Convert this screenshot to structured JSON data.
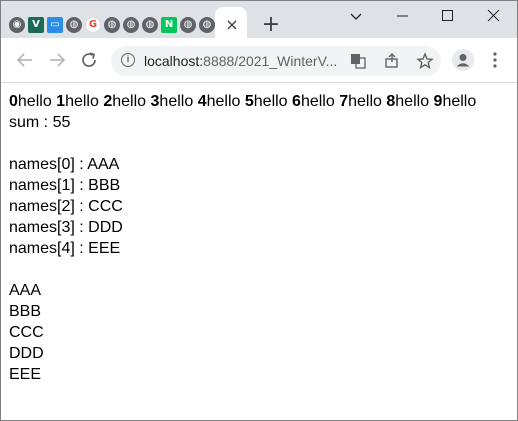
{
  "browser": {
    "favicons": [
      "github-icon",
      "v-icon",
      "chat-icon",
      "globe-icon",
      "google-icon",
      "globe-icon",
      "globe-icon",
      "globe-icon",
      "naver-icon",
      "globe-icon",
      "globe-icon"
    ],
    "url_host": "localhost:",
    "url_rest": "8888/2021_WinterV...",
    "tab_close_glyph": "×",
    "new_tab_glyph": "+"
  },
  "page": {
    "hello_items": [
      {
        "index": "0",
        "text": "hello"
      },
      {
        "index": "1",
        "text": "hello"
      },
      {
        "index": "2",
        "text": "hello"
      },
      {
        "index": "3",
        "text": "hello"
      },
      {
        "index": "4",
        "text": "hello"
      },
      {
        "index": "5",
        "text": "hello"
      },
      {
        "index": "6",
        "text": "hello"
      },
      {
        "index": "7",
        "text": "hello"
      },
      {
        "index": "8",
        "text": "hello"
      },
      {
        "index": "9",
        "text": "hello"
      }
    ],
    "sum_line": "sum : 55",
    "names_indexed": [
      "names[0] : AAA",
      "names[1] : BBB",
      "names[2] : CCC",
      "names[3] : DDD",
      "names[4] : EEE"
    ],
    "names_plain": [
      "AAA",
      "BBB",
      "CCC",
      "DDD",
      "EEE"
    ]
  }
}
